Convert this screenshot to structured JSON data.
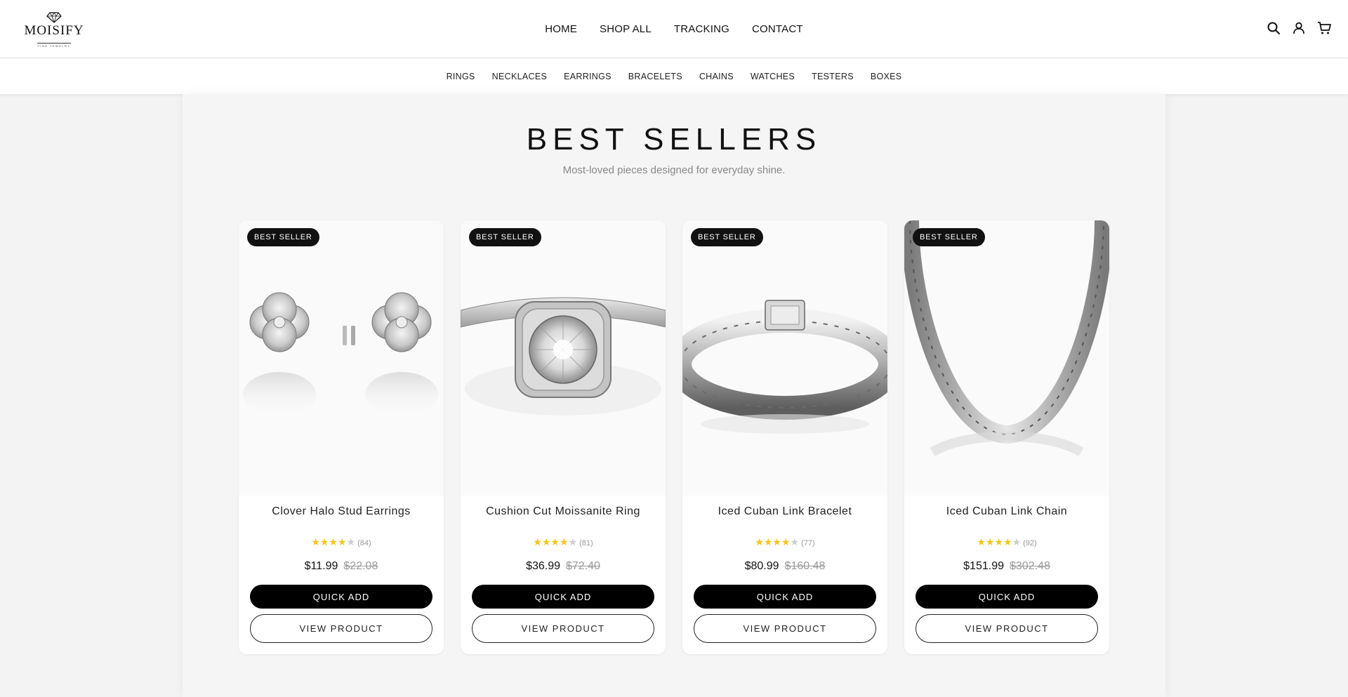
{
  "brand": {
    "name": "MOISIFY",
    "tagline": "FINE JEWELRY"
  },
  "main_nav": [
    "HOME",
    "SHOP ALL",
    "TRACKING",
    "CONTACT"
  ],
  "header_icons": [
    "search-icon",
    "account-icon",
    "cart-icon"
  ],
  "category_nav": [
    "RINGS",
    "NECKLACES",
    "EARRINGS",
    "BRACELETS",
    "CHAINS",
    "WATCHES",
    "TESTERS",
    "BOXES"
  ],
  "section": {
    "title": "BEST SELLERS",
    "subtitle": "Most-loved pieces designed for everyday shine."
  },
  "products": [
    {
      "badge": "BEST SELLER",
      "name": "Clover Halo Stud Earrings",
      "stars": 4,
      "reviews": "(84)",
      "price": "$11.99",
      "compare_price": "$22.08",
      "quick_add": "QUICK ADD",
      "view": "VIEW PRODUCT",
      "image": "earrings"
    },
    {
      "badge": "BEST SELLER",
      "name": "Cushion Cut Moissanite Ring",
      "stars": 4,
      "reviews": "(81)",
      "price": "$36.99",
      "compare_price": "$72.40",
      "quick_add": "QUICK ADD",
      "view": "VIEW PRODUCT",
      "image": "ring"
    },
    {
      "badge": "BEST SELLER",
      "name": "Iced Cuban Link Bracelet",
      "stars": 4,
      "reviews": "(77)",
      "price": "$80.99",
      "compare_price": "$160.48",
      "quick_add": "QUICK ADD",
      "view": "VIEW PRODUCT",
      "image": "bracelet"
    },
    {
      "badge": "BEST SELLER",
      "name": "Iced Cuban Link Chain",
      "stars": 4,
      "reviews": "(92)",
      "price": "$151.99",
      "compare_price": "$302.48",
      "quick_add": "QUICK ADD",
      "view": "VIEW PRODUCT",
      "image": "chain"
    }
  ],
  "colors": {
    "accent": "#000000",
    "star": "#f5c518",
    "muted": "#999999",
    "background": "#f5f5f5"
  }
}
